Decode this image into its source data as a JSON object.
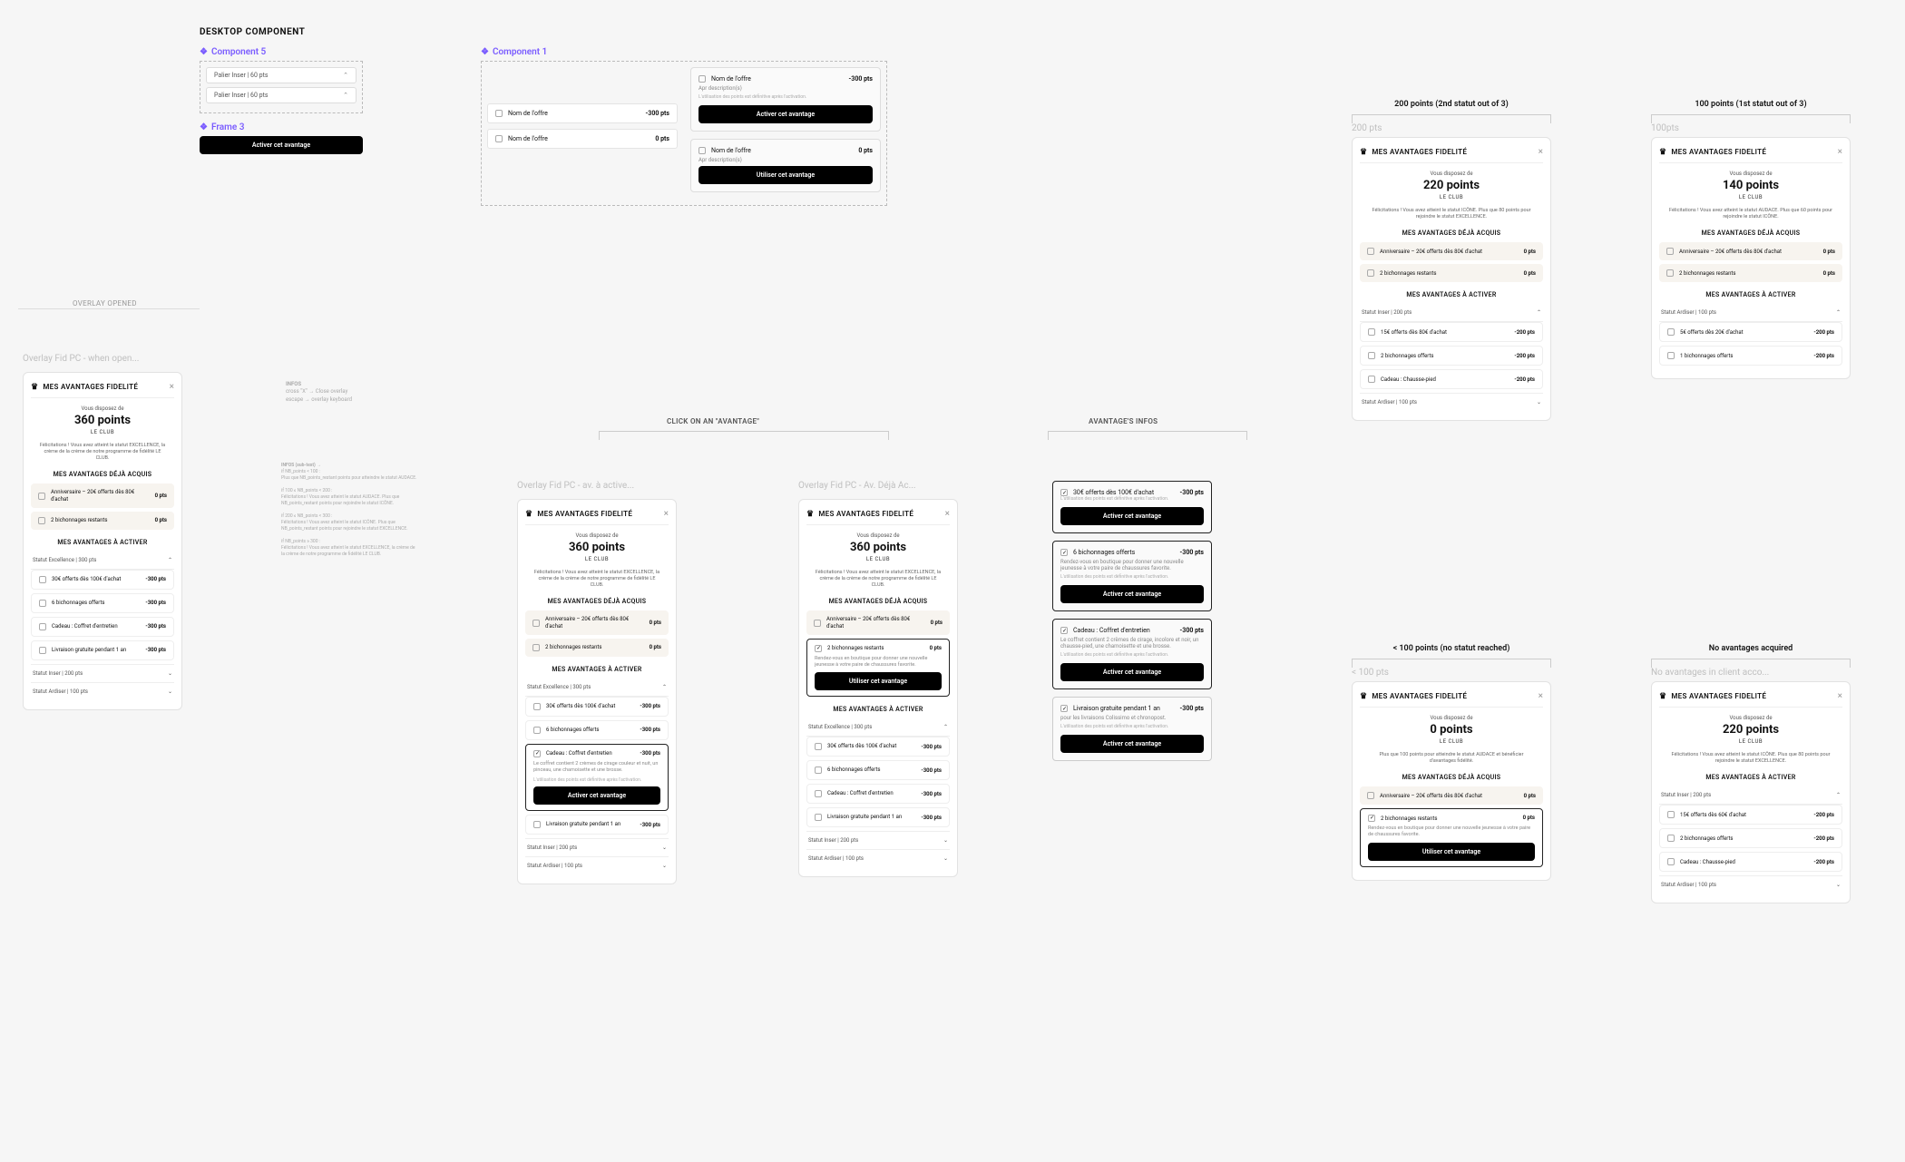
{
  "labels": {
    "desktop_component": "DESKTOP COMPONENT",
    "component5": "Component 5",
    "component1": "Component 1",
    "frame3": "Frame 3",
    "overlay_opened": "OVERLAY OPENED",
    "click_on_avantage": "CLICK ON AN \"AVANTAGE\"",
    "avantage_infos": "AVANTAGE'S INFOS",
    "col_200": "200 points (2nd statut out of 3)",
    "col_100": "100 points (1st statut out of 3)",
    "col_lt100": "< 100 points (no statut reached)",
    "col_noav": "No avantages acquired",
    "ghost_200": "200 pts",
    "ghost_100": "100pts",
    "ghost_lt100": "< 100 pts",
    "ghost_noav": "No avantages in client acco..."
  },
  "buttons": {
    "activer": "Activer cet avantage",
    "utiliser": "Utiliser cet avantage"
  },
  "strings": {
    "panel_title": "MES AVANTAGES FIDELITÉ",
    "points_caption": "Vous disposez de",
    "le_club": "LE CLUB",
    "acquired_heading": "MES AVANTAGES DÉJÀ ACQUIS",
    "activate_heading": "MES AVANTAGES À ACTIVER",
    "nom_offre": "Nom de l'offre",
    "apr_desc": "Apr description(s)",
    "fine": "L'utilisation des points est définitive après l'activation.",
    "fine2": "L'utilisation des points est définitive après l'activation.",
    "palier_60": "Palier Inser | 60 pts",
    "pts0": "0 pts",
    "neg300": "-300 pts",
    "neg200": "-200 pts"
  },
  "component5": {
    "rows": [
      "Palier Inser | 60 pts",
      "Palier Inser | 60 pts"
    ]
  },
  "ghost_overlay": "Overlay Fid PC - when open...",
  "ghost_click1": "Overlay Fid PC - av. à active...",
  "ghost_click2": "Overlay Fid PC - Av. Déjà Ac...",
  "notes1": {
    "l1": "INFOS",
    "l2": "cross \"X\" → Close overlay",
    "l3": "escape → overlay keyboard"
  },
  "notes2": {
    "h": "INFOS (sub-text) →",
    "a": "if NB_points < 100 :",
    "a2": "Plus que NB_points_restant points pour atteindre le statut AUDACE.",
    "b": "if 100 ≤ NB_points < 200 :",
    "b2": "Félicitations ! Vous avez atteint le statut AUDACE. Plus que NB_points_restant points pour rejoindre le statut ICÔNE.",
    "c": "if 200 ≤ NB_points < 300 :",
    "c2": "Félicitations ! Vous avez atteint le statut ICÔNE. Plus que NB_points_restant points pour rejoindre le statut EXCELLENCE.",
    "d": "if NB_points ≥ 300 :",
    "d2": "Félicitations ! Vous avez atteint le statut EXCELLENCE, la crème de la crème de notre programme de fidélité LE CLUB."
  },
  "panels": {
    "open": {
      "points": "360 points",
      "blurb": "Félicitations ! Vous avez atteint le statut EXCELLENCE, la crème de la crème de notre programme de fidélité LE CLUB.",
      "acquired": [
        {
          "label": "Anniversaire – 20€ offerts dès 80€ d'achat",
          "pts": "0 pts"
        },
        {
          "label": "2 bichonnages restants",
          "pts": "0 pts"
        }
      ],
      "status_label": "Statut Excellence | 300 pts",
      "activate": [
        {
          "label": "30€ offerts dès 100€ d'achat",
          "pts": "-300 pts"
        },
        {
          "label": "6 bichonnages offerts",
          "pts": "-300 pts"
        },
        {
          "label": "Cadeau : Coffret d'entretien",
          "pts": "-300 pts"
        },
        {
          "label": "Livraison gratuite pendant 1 an",
          "pts": "-300 pts"
        }
      ],
      "footer_status": [
        "Statut Inser | 200 pts",
        "Statut Ardiser | 100 pts"
      ]
    },
    "click_a": {
      "points": "360 points",
      "blurb": "Félicitations ! Vous avez atteint le statut EXCELLENCE, la crème de la crème de notre programme de fidélité LE CLUB.",
      "acquired": [
        {
          "label": "Anniversaire – 20€ offerts dès 80€ d'achat",
          "pts": "0 pts"
        },
        {
          "label": "2 bichonnages restants",
          "pts": "0 pts"
        }
      ],
      "status_label": "Statut Excellence | 300 pts",
      "activate": [
        {
          "label": "30€ offerts dès 100€ d'achat",
          "pts": "-300 pts"
        },
        {
          "label": "6 bichonnages offerts",
          "pts": "-300 pts"
        }
      ],
      "selected": {
        "label": "Cadeau : Coffret d'entretien",
        "pts": "-300 pts",
        "desc": "Le coffret contient 2 crèmes de cirage couleur et nuit, un pinceau, une chamoisette et une brosse.",
        "fine": "L'utilisation des points est définitive après l'activation."
      },
      "after": [
        {
          "label": "Livraison gratuite pendant 1 an",
          "pts": "-300 pts"
        }
      ],
      "footer_status": [
        "Statut Inser | 200 pts",
        "Statut Ardiser | 100 pts"
      ]
    },
    "click_b": {
      "points": "360 points",
      "blurb": "Félicitations ! Vous avez atteint le statut EXCELLENCE, la crème de la crème de notre programme de fidélité LE CLUB.",
      "acquired_first": {
        "label": "Anniversaire – 20€ offerts dès 80€ d'achat",
        "pts": "0 pts"
      },
      "selected": {
        "label": "2 bichonnages restants",
        "pts": "0 pts",
        "desc": "Rendez-vous en boutique pour donner une nouvelle jeunesse à votre paire de chaussures favorite."
      },
      "status_label": "Statut Excellence | 300 pts",
      "activate": [
        {
          "label": "30€ offerts dès 100€ d'achat",
          "pts": "-300 pts"
        },
        {
          "label": "6 bichonnages offerts",
          "pts": "-300 pts"
        },
        {
          "label": "Cadeau : Coffret d'entretien",
          "pts": "-300 pts"
        },
        {
          "label": "Livraison gratuite pendant 1 an",
          "pts": "-300 pts"
        }
      ],
      "footer_status": [
        "Statut Inser | 200 pts",
        "Statut Ardiser | 100 pts"
      ]
    },
    "p200": {
      "points": "220 points",
      "blurb": "Félicitations ! Vous avez atteint le statut ICÔNE. Plus que 80 points pour rejoindre le statut EXCELLENCE.",
      "acquired": [
        {
          "label": "Anniversaire – 20€ offerts dès 80€ d'achat",
          "pts": "0 pts"
        },
        {
          "label": "2 bichonnages restants",
          "pts": "0 pts"
        }
      ],
      "status_label": "Statut Inser | 200 pts",
      "activate": [
        {
          "label": "15€ offerts dès 80€ d'achat",
          "pts": "-200 pts"
        },
        {
          "label": "2 bichonnages offerts",
          "pts": "-200 pts"
        },
        {
          "label": "Cadeau : Chausse-pied",
          "pts": "-200 pts"
        }
      ],
      "footer_status": [
        "Statut Ardiser | 100 pts"
      ]
    },
    "p100": {
      "points": "140 points",
      "blurb": "Félicitations ! Vous avez atteint le statut AUDACE. Plus que 60 points pour rejoindre le statut ICÔNE.",
      "acquired": [
        {
          "label": "Anniversaire – 20€ offerts dès 80€ d'achat",
          "pts": "0 pts"
        },
        {
          "label": "2 bichonnages restants",
          "pts": "0 pts"
        }
      ],
      "status_label": "Statut Ardiser | 100 pts",
      "activate": [
        {
          "label": "5€ offerts dès 20€ d'achat",
          "pts": "-200 pts"
        },
        {
          "label": "1 bichonnages offerts",
          "pts": "-200 pts"
        }
      ]
    },
    "plt100": {
      "points": "0 points",
      "blurb": "Plus que 100 points pour atteindre le statut AUDACE et bénéficier d'avantages fidélité.",
      "acquired_first": {
        "label": "Anniversaire – 20€ offerts dès 80€ d'achat",
        "pts": "0 pts"
      },
      "selected": {
        "label": "2 bichonnages restants",
        "pts": "0 pts",
        "desc": "Rendez-vous en boutique pour donner une nouvelle jeunesse à votre paire de chaussures favorite."
      }
    },
    "pnoav": {
      "points": "220 points",
      "blurb": "Félicitations ! Vous avez atteint le statut ICÔNE. Plus que 80 points pour rejoindre le statut EXCELLENCE.",
      "status_label": "Statut Inser | 200 pts",
      "activate": [
        {
          "label": "15€ offerts dès 60€ d'achat",
          "pts": "-200 pts"
        },
        {
          "label": "2 bichonnages offerts",
          "pts": "-200 pts"
        },
        {
          "label": "Cadeau : Chausse-pied",
          "pts": "-200 pts"
        }
      ],
      "footer_status": [
        "Statut Ardiser | 100 pts"
      ]
    }
  },
  "infos": {
    "cards": [
      {
        "label": "30€ offerts dès 100€ d'achat",
        "pts": "-300 pts",
        "fine": "L'utilisation des points est définitive après l'activation.",
        "btn": "activer"
      },
      {
        "label": "6 bichonnages offerts",
        "pts": "-300 pts",
        "desc": "Rendez-vous en boutique pour donner une nouvelle jeunesse à votre paire de chaussures favorite.",
        "fine": "L'utilisation des points est définitive après l'activation.",
        "btn": "activer"
      },
      {
        "label": "Cadeau : Coffret d'entretien",
        "pts": "-300 pts",
        "desc": "Le coffret contient 2 crèmes de cirage, incolore et noir, un chausse-pied, une chamoisette et une brosse.",
        "fine": "L'utilisation des points est définitive après l'activation.",
        "btn": "activer"
      },
      {
        "label": "Livraison gratuite pendant 1 an",
        "pts": "-300 pts",
        "desc": "pour les livraisons Colissimo et chronopost.",
        "fine": "L'utilisation des points est définitive après l'activation.",
        "btn": "activer"
      }
    ]
  }
}
